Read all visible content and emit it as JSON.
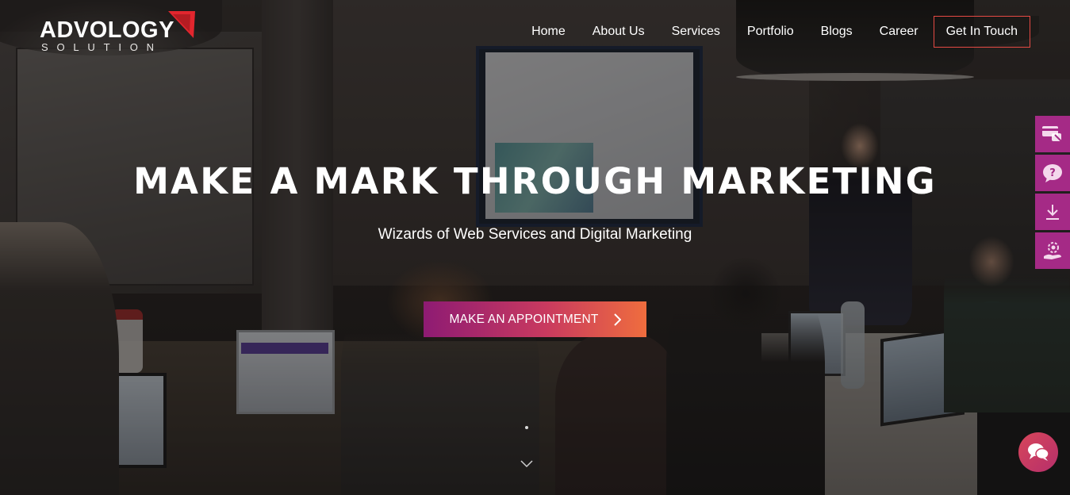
{
  "brand": {
    "name": "ADVOLOGY",
    "tagline": "SOLUTION",
    "accent_color": "#e2262e"
  },
  "nav": {
    "items": [
      {
        "label": "Home"
      },
      {
        "label": "About Us"
      },
      {
        "label": "Services"
      },
      {
        "label": "Portfolio"
      },
      {
        "label": "Blogs"
      },
      {
        "label": "Career"
      }
    ],
    "cta_label": "Get In Touch",
    "cta_border_color": "#e54a44"
  },
  "hero": {
    "title": "MAKE A MARK THROUGH MARKETING",
    "subtitle": "Wizards of Web Services and Digital Marketing",
    "cta_label": "MAKE AN APPOINTMENT",
    "cta_icon": "chevron-right-icon",
    "cta_gradient": [
      "#8e1b73",
      "#c93a5f",
      "#ef6d3e"
    ]
  },
  "side_tabs": [
    {
      "icon": "payment-card-icon"
    },
    {
      "icon": "help-bubble-icon"
    },
    {
      "icon": "download-icon"
    },
    {
      "icon": "hand-gear-icon"
    }
  ],
  "side_tab_color": "#a52a86",
  "scroll_indicator": {
    "icon": "chevron-down-icon"
  },
  "chat": {
    "icon": "chat-bubbles-icon",
    "color": "#c93a5f"
  }
}
